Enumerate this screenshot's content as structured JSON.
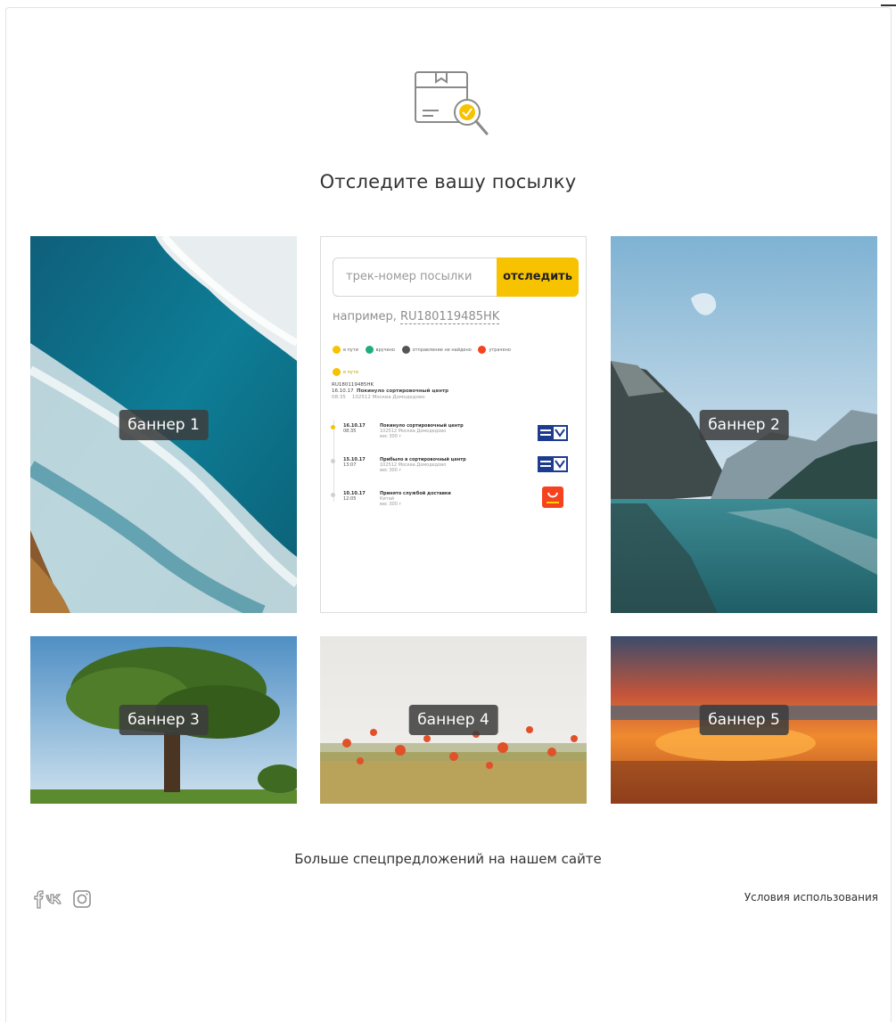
{
  "header": {
    "title": "Отследите вашу посылку",
    "icon": "parcel-search-icon"
  },
  "banners": [
    {
      "label": "баннер 1",
      "image": "ocean-waves-aerial"
    },
    {
      "label": "баннер 2",
      "image": "mountain-lake"
    },
    {
      "label": "баннер 3",
      "image": "tree-in-field"
    },
    {
      "label": "баннер 4",
      "image": "poppy-field"
    },
    {
      "label": "баннер 5",
      "image": "sunset-sea"
    }
  ],
  "tracker": {
    "placeholder": "трек-номер посылки",
    "button": "отследить",
    "example_prefix": "например, ",
    "example_number": "RU180119485HK",
    "legend": [
      "в пути",
      "вручено",
      "отправление не найдено",
      "утрачено"
    ],
    "legend_colors": [
      "#f7c200",
      "#1fae7a",
      "#555555",
      "#f5431f"
    ],
    "current_status": "в пути",
    "summary": {
      "track": "RU180119485HK",
      "date": "16.10.17",
      "time": "08:35",
      "title": "Покинуло сортировочный центр",
      "place": "102512 Москва Домодедово"
    },
    "events": [
      {
        "date": "16.10.17",
        "time": "08:35",
        "title": "Покинуло сортировочный центр",
        "place": "102512 Москва Домодедово",
        "weight": "вес 300 г",
        "carrier": "Почта России"
      },
      {
        "date": "15.10.17",
        "time": "13:07",
        "title": "Прибыло в сортировочный центр",
        "place": "102512 Москва Домодедово",
        "weight": "вес 300 г",
        "carrier": "Почта России"
      },
      {
        "date": "10.10.17",
        "time": "12:05",
        "title": "Принято службой доставки",
        "place": "Китай",
        "weight": "вес 300 г",
        "carrier": "AliExpress"
      }
    ]
  },
  "footer": {
    "more_offers": "Больше спецпредложений на нашем сайте",
    "terms": "Условия использования",
    "social": [
      "facebook-icon",
      "vk-icon",
      "instagram-icon"
    ]
  }
}
